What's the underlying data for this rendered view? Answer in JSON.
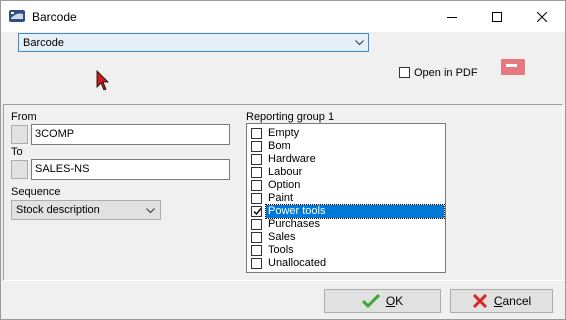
{
  "window": {
    "title": "Barcode"
  },
  "icons": {
    "app": "barcode-app-icon",
    "minimize": "minimize-icon",
    "maximize": "maximize-icon",
    "close": "close-icon",
    "pdf": "pdf-icon",
    "ok": "green-check-icon",
    "cancel": "red-x-icon"
  },
  "top": {
    "report_select": {
      "value": "Barcode"
    },
    "open_in_pdf": {
      "label": "Open in PDF",
      "checked": false
    }
  },
  "filters": {
    "from_label": "From",
    "from_value": "3COMP",
    "to_label": "To",
    "to_value": "SALES-NS",
    "sequence_label": "Sequence",
    "sequence_value": "Stock description"
  },
  "reporting_group": {
    "label": "Reporting group 1",
    "items": [
      {
        "label": "Empty",
        "checked": false,
        "selected": false
      },
      {
        "label": "Bom",
        "checked": false,
        "selected": false
      },
      {
        "label": "Hardware",
        "checked": false,
        "selected": false
      },
      {
        "label": "Labour",
        "checked": false,
        "selected": false
      },
      {
        "label": "Option",
        "checked": false,
        "selected": false
      },
      {
        "label": "Paint",
        "checked": false,
        "selected": false
      },
      {
        "label": "Power tools",
        "checked": true,
        "selected": true
      },
      {
        "label": "Purchases",
        "checked": false,
        "selected": false
      },
      {
        "label": "Sales",
        "checked": false,
        "selected": false
      },
      {
        "label": "Tools",
        "checked": false,
        "selected": false
      },
      {
        "label": "Unallocated",
        "checked": false,
        "selected": false
      }
    ]
  },
  "footer": {
    "ok_mnemonic": "O",
    "ok_rest": "K",
    "cancel_mnemonic": "C",
    "cancel_rest": "ancel"
  },
  "colors": {
    "selection": "#0078d7",
    "accent_border": "#3b8bd4",
    "pdf_icon": "#e87880",
    "ok_icon": "#3aa832",
    "cancel_icon": "#d9262b"
  }
}
